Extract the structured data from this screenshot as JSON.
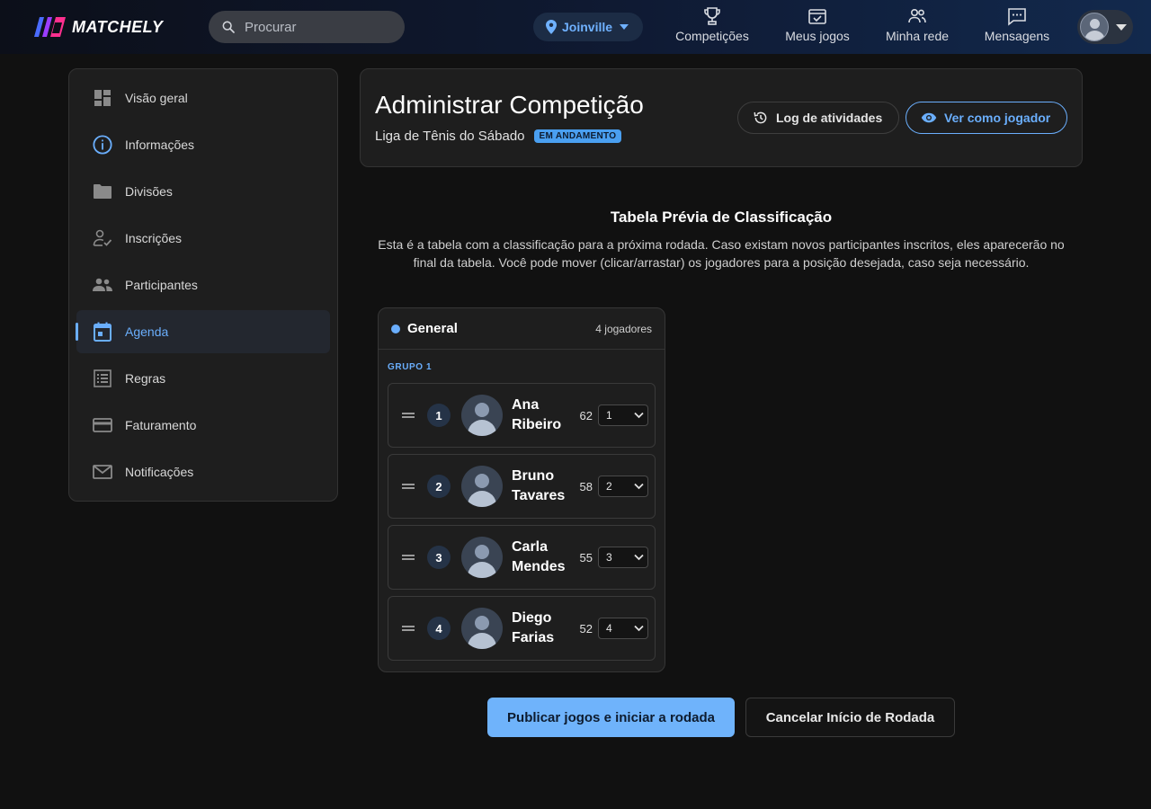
{
  "app": {
    "logo_text": "MATCHELY",
    "search_placeholder": "Procurar",
    "city": "Joinville",
    "nav": [
      {
        "label": "Competições",
        "icon": "trophy-icon"
      },
      {
        "label": "Meus jogos",
        "icon": "calendar-check-icon"
      },
      {
        "label": "Minha rede",
        "icon": "people-icon"
      },
      {
        "label": "Mensagens",
        "icon": "chat-icon"
      }
    ]
  },
  "sidebar": {
    "items": [
      {
        "label": "Visão geral",
        "icon": "dashboard-icon",
        "active": false
      },
      {
        "label": "Informações",
        "icon": "info-icon",
        "active": false
      },
      {
        "label": "Divisões",
        "icon": "folder-icon",
        "active": false
      },
      {
        "label": "Inscrições",
        "icon": "person-check-icon",
        "active": false
      },
      {
        "label": "Participantes",
        "icon": "people-icon",
        "active": false
      },
      {
        "label": "Agenda",
        "icon": "calendar-icon",
        "active": true
      },
      {
        "label": "Regras",
        "icon": "list-icon",
        "active": false
      },
      {
        "label": "Faturamento",
        "icon": "credit-card-icon",
        "active": false
      },
      {
        "label": "Notificações",
        "icon": "mail-icon",
        "active": false
      }
    ]
  },
  "header": {
    "title": "Administrar Competição",
    "subtitle": "Liga de Tênis do Sábado",
    "status_badge": "EM ANDAMENTO",
    "log_button": "Log de atividades",
    "view_button": "Ver como jogador"
  },
  "preview": {
    "title": "Tabela Prévia de Classificação",
    "description": "Esta é a tabela com a classificação para a próxima rodada. Caso existam novos participantes inscritos, eles aparecerão no final da tabela. Você pode mover (clicar/arrastar) os jogadores para a posição desejada, caso seja necessário.",
    "group": {
      "name": "General",
      "count": "4 jogadores",
      "sub_label": "GRUPO 1",
      "players": [
        {
          "position": "1",
          "first": "Ana",
          "last": "Ribeiro",
          "score": "62",
          "select": "1"
        },
        {
          "position": "2",
          "first": "Bruno",
          "last": "Tavares",
          "score": "58",
          "select": "2"
        },
        {
          "position": "3",
          "first": "Carla",
          "last": "Mendes",
          "score": "55",
          "select": "3"
        },
        {
          "position": "4",
          "first": "Diego",
          "last": "Farias",
          "score": "52",
          "select": "4"
        }
      ]
    }
  },
  "actions": {
    "publish": "Publicar jogos e iniciar a rodada",
    "cancel": "Cancelar Início de Rodada"
  }
}
